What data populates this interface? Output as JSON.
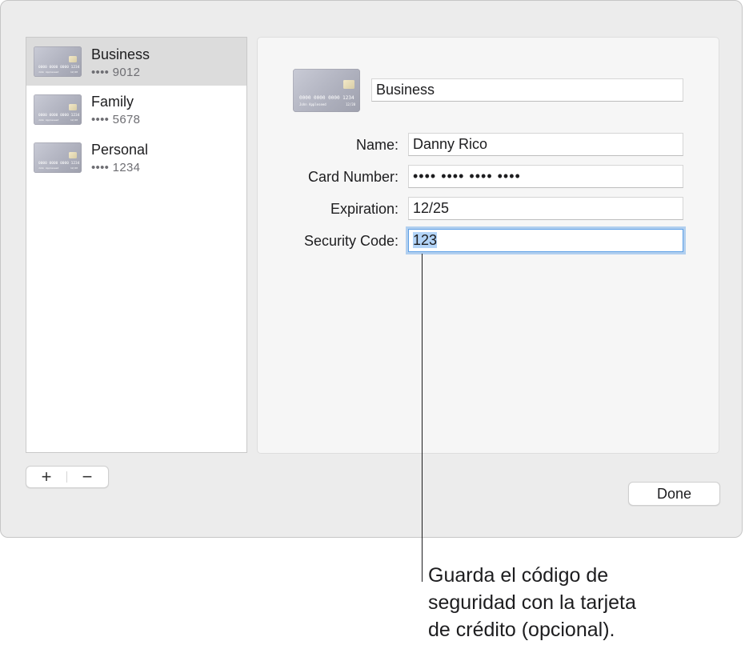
{
  "sidebar": {
    "cards": [
      {
        "name": "Business",
        "last4": "•••• 9012",
        "selected": true
      },
      {
        "name": "Family",
        "last4": "•••• 5678",
        "selected": false
      },
      {
        "name": "Personal",
        "last4": "•••• 1234",
        "selected": false
      }
    ],
    "thumb": {
      "number": "0000 0000 0000 1234",
      "holder": "John Appleseed",
      "expiry": "12/20"
    },
    "add_label": "+",
    "remove_label": "−"
  },
  "detail": {
    "card_title": "Business",
    "fields": {
      "name": {
        "label": "Name:",
        "value": "Danny Rico"
      },
      "card_number": {
        "label": "Card Number:",
        "value": "•••• •••• •••• ••••"
      },
      "expiration": {
        "label": "Expiration:",
        "value": "12/25"
      },
      "security_code": {
        "label": "Security Code:",
        "value": "123"
      }
    }
  },
  "footer": {
    "done_label": "Done"
  },
  "callout": {
    "lines": [
      "Guarda el código de",
      "seguridad con la tarjeta",
      "de crédito (opcional)."
    ]
  }
}
